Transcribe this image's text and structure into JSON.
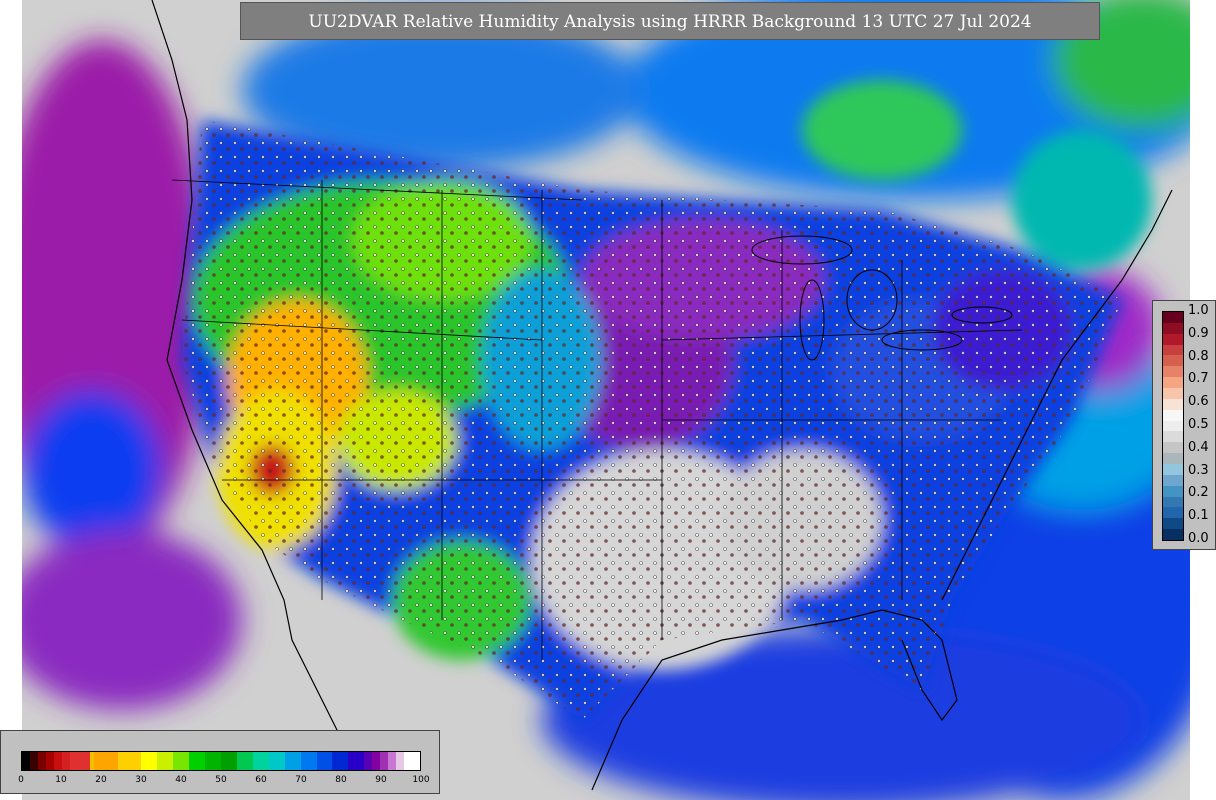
{
  "title": "UU2DVAR Relative Humidity Analysis using HRRR Background 13 UTC 27 Jul 2024",
  "obs_colorbar": {
    "ticks": [
      "1.0",
      "0.9",
      "0.8",
      "0.7",
      "0.6",
      "0.5",
      "0.4",
      "0.3",
      "0.2",
      "0.1",
      "0.0"
    ],
    "colors": [
      "#67001f",
      "#8f0c25",
      "#b2182b",
      "#c6413e",
      "#d6604d",
      "#e58267",
      "#f4a582",
      "#f8c5ab",
      "#f7e3d6",
      "#f7f7f7",
      "#ededed",
      "#dbdbdb",
      "#c5c5c5",
      "#a9b7bd",
      "#92c5de",
      "#6ea6cd",
      "#4393c3",
      "#3378b0",
      "#2166ac",
      "#104a85",
      "#053061"
    ]
  },
  "rh_colorbar": {
    "ticks": [
      "0",
      "10",
      "20",
      "30",
      "40",
      "50",
      "60",
      "70",
      "80",
      "90",
      "100"
    ],
    "colors": [
      "#000000",
      "#3a0000",
      "#7a0000",
      "#a60000",
      "#c80f0f",
      "#d42020",
      "#e03030",
      "#f5c000",
      "#ffa500",
      "#ffd000",
      "#ffff00",
      "#c8f000",
      "#78e600",
      "#00d000",
      "#00b400",
      "#00a000",
      "#00c850",
      "#00d2a0",
      "#00c8c8",
      "#00a0e6",
      "#0078f0",
      "#0050e6",
      "#0028d2",
      "#2800c8",
      "#5a00b4",
      "#8200a0",
      "#a030b4",
      "#c878d2",
      "#e6c8e6",
      "#ffffff"
    ],
    "stops": [
      0,
      2,
      4,
      6,
      8,
      10,
      12,
      17,
      18,
      24,
      30,
      34,
      38,
      42,
      46,
      50,
      54,
      58,
      62,
      66,
      70,
      74,
      78,
      82,
      86,
      88,
      90,
      92,
      94,
      96,
      100
    ]
  }
}
